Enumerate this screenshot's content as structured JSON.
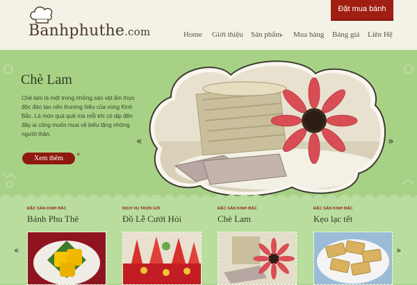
{
  "header": {
    "logo_text": "Banhphuthe",
    "logo_domain": ".com",
    "order_button": "Đặt mua bánh",
    "nav": [
      {
        "label": "Home"
      },
      {
        "label": "Giới thiệu"
      },
      {
        "label": "Sản phẩm"
      },
      {
        "label": "Mua hàng"
      },
      {
        "label": "Bảng giá"
      },
      {
        "label": "Liên Hệ"
      }
    ]
  },
  "hero": {
    "title": "Chè Lam",
    "description": "Chè lam là một trong những sản vật ẩm thực độc đáo tạo nên thương hiệu của vùng Kinh Bắc. Là món quà quê mà mỗi khi có dịp đến đây ai cũng muốn mua về biếu tặng những người thân.",
    "more_button": "Xem thêm"
  },
  "cards": [
    {
      "category": "ĐẶC SẢN KINH BẮC",
      "title": "Bánh Phu Thê"
    },
    {
      "category": "DỊCH VỤ TRỌN GÓI",
      "title": "Đồ Lễ Cưới Hỏi"
    },
    {
      "category": "ĐẶC SẢN KINH BẮC",
      "title": "Chè Lam"
    },
    {
      "category": "ĐẶC SẢN KINH BẮC",
      "title": "Kẹo lạc tết"
    }
  ],
  "colors": {
    "accent": "#a01e12",
    "green": "#a7d286",
    "header": "#f4f1e6"
  }
}
